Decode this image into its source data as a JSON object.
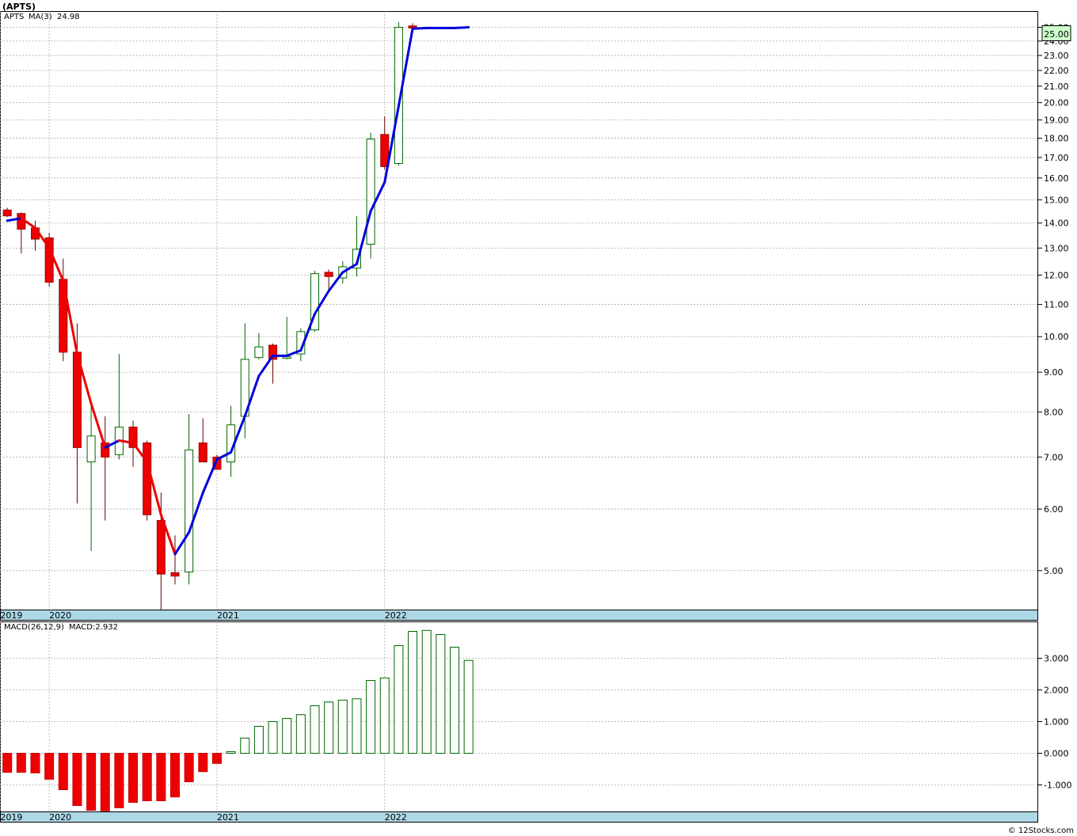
{
  "header": {
    "symbol": "(APTS)"
  },
  "watermark": "© 12Stocks.com",
  "chart_data": [
    {
      "type": "candlestick",
      "panel": "price",
      "legend": {
        "ticker": "APTS",
        "ma_label": "MA(3)",
        "ma_value": "24.98"
      },
      "last_price_label": "25.00",
      "y_scale": "log",
      "ylim": [
        4.45,
        26.2
      ],
      "y_ticks": [
        5,
        6,
        7,
        8,
        9,
        10,
        11,
        12,
        13,
        14,
        15,
        16,
        17,
        18,
        19,
        20,
        21,
        22,
        23,
        24,
        25
      ],
      "y_tick_labels": [
        "5.00",
        "6.00",
        "7.00",
        "8.00",
        "9.00",
        "10.00",
        "11.00",
        "12.00",
        "13.00",
        "14.00",
        "15.00",
        "16.00",
        "17.00",
        "18.00",
        "19.00",
        "20.00",
        "21.00",
        "22.00",
        "23.00",
        "24.00",
        "25.00"
      ],
      "x_labels": [
        {
          "text": "2019",
          "index": -0.5
        },
        {
          "text": "2020",
          "index": 3.0
        },
        {
          "text": "2021",
          "index": 15.0
        },
        {
          "text": "2022",
          "index": 27.0
        }
      ],
      "candles": [
        {
          "o": 14.55,
          "h": 14.65,
          "l": 14.25,
          "c": 14.3
        },
        {
          "o": 14.4,
          "h": 14.45,
          "l": 12.8,
          "c": 13.75
        },
        {
          "o": 13.8,
          "h": 14.1,
          "l": 12.9,
          "c": 13.35
        },
        {
          "o": 13.4,
          "h": 13.6,
          "l": 11.6,
          "c": 11.75
        },
        {
          "o": 11.85,
          "h": 12.6,
          "l": 9.3,
          "c": 9.55
        },
        {
          "o": 9.55,
          "h": 10.4,
          "l": 6.1,
          "c": 7.2
        },
        {
          "o": 6.9,
          "h": 8.2,
          "l": 5.3,
          "c": 7.45
        },
        {
          "o": 7.3,
          "h": 7.9,
          "l": 5.8,
          "c": 7.0
        },
        {
          "o": 7.05,
          "h": 9.5,
          "l": 6.95,
          "c": 7.65
        },
        {
          "o": 7.65,
          "h": 7.8,
          "l": 6.8,
          "c": 7.2
        },
        {
          "o": 7.3,
          "h": 7.35,
          "l": 5.8,
          "c": 5.9
        },
        {
          "o": 5.8,
          "h": 6.3,
          "l": 4.45,
          "c": 4.95
        },
        {
          "o": 4.97,
          "h": 5.55,
          "l": 4.8,
          "c": 4.92
        },
        {
          "o": 4.98,
          "h": 7.95,
          "l": 4.8,
          "c": 7.15
        },
        {
          "o": 7.3,
          "h": 7.85,
          "l": 6.9,
          "c": 6.9
        },
        {
          "o": 7.0,
          "h": 7.05,
          "l": 6.75,
          "c": 6.75
        },
        {
          "o": 6.9,
          "h": 8.15,
          "l": 6.6,
          "c": 7.7
        },
        {
          "o": 7.9,
          "h": 10.4,
          "l": 7.4,
          "c": 9.35
        },
        {
          "o": 9.4,
          "h": 10.1,
          "l": 9.35,
          "c": 9.7
        },
        {
          "o": 9.75,
          "h": 9.8,
          "l": 8.7,
          "c": 9.35
        },
        {
          "o": 9.4,
          "h": 10.6,
          "l": 9.35,
          "c": 9.42
        },
        {
          "o": 9.5,
          "h": 10.25,
          "l": 9.3,
          "c": 10.15
        },
        {
          "o": 10.2,
          "h": 12.15,
          "l": 10.15,
          "c": 12.05
        },
        {
          "o": 12.1,
          "h": 12.2,
          "l": 11.4,
          "c": 11.95
        },
        {
          "o": 11.9,
          "h": 12.5,
          "l": 11.7,
          "c": 12.3
        },
        {
          "o": 12.25,
          "h": 14.3,
          "l": 11.95,
          "c": 12.95
        },
        {
          "o": 13.15,
          "h": 18.3,
          "l": 12.6,
          "c": 17.95
        },
        {
          "o": 18.2,
          "h": 19.2,
          "l": 16.4,
          "c": 16.55
        },
        {
          "o": 16.7,
          "h": 25.4,
          "l": 16.6,
          "c": 25.0
        },
        {
          "o": 25.1,
          "h": 25.3,
          "l": 24.65,
          "c": 24.95
        }
      ],
      "moving_average": {
        "name": "MA(3)",
        "start_index": 0,
        "values": [
          14.1,
          14.2,
          13.8,
          13.0,
          11.8,
          9.5,
          8.2,
          7.2,
          7.35,
          7.3,
          6.9,
          5.9,
          5.25,
          5.6,
          6.3,
          6.95,
          7.1,
          7.9,
          8.9,
          9.45,
          9.45,
          9.6,
          10.7,
          11.45,
          12.1,
          12.4,
          14.5,
          15.8,
          19.8,
          24.9,
          24.95,
          24.95,
          24.95,
          25.0
        ]
      },
      "ma_colors": {
        "up": "#0000dd",
        "down": "#ee0000"
      }
    },
    {
      "type": "bar",
      "panel": "macd",
      "legend": {
        "name": "MACD(26,12,9)",
        "value_label": "MACD:2.932"
      },
      "ylim": [
        -1.85,
        4.15
      ],
      "y_ticks": [
        -1,
        0,
        1,
        2,
        3
      ],
      "y_tick_labels": [
        "-1.000",
        "0.000",
        "1.000",
        "2.000",
        "3.000"
      ],
      "x_labels": [
        {
          "text": "2019",
          "index": -0.5
        },
        {
          "text": "2020",
          "index": 3.0
        },
        {
          "text": "2021",
          "index": 15.0
        },
        {
          "text": "2022",
          "index": 27.0
        }
      ],
      "values": [
        -0.6,
        -0.6,
        -0.62,
        -0.82,
        -1.15,
        -1.65,
        -1.8,
        -1.82,
        -1.72,
        -1.55,
        -1.5,
        -1.5,
        -1.38,
        -0.9,
        -0.58,
        -0.32,
        0.05,
        0.48,
        0.85,
        1.0,
        1.1,
        1.22,
        1.5,
        1.62,
        1.68,
        1.72,
        2.3,
        2.38,
        3.4,
        3.85,
        3.88,
        3.75,
        3.35,
        2.932
      ]
    }
  ],
  "colors": {
    "up_candle_fill": "#ffffff",
    "up_candle_stroke": "#006600",
    "down_candle": "#ee0000",
    "date_strip": "#add8e6",
    "grid": "#aaaaaa",
    "price_tag": "#ccffcc"
  }
}
